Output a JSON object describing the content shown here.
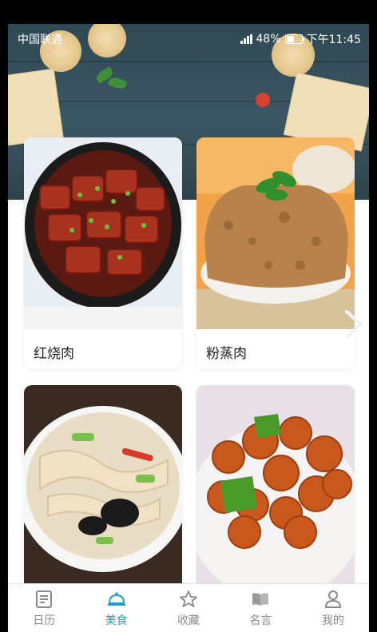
{
  "status_bar": {
    "carrier": "中国联通",
    "battery": "48%",
    "time": "下午11:45"
  },
  "dishes": [
    {
      "name": "红烧肉"
    },
    {
      "name": "粉蒸肉"
    },
    {
      "name": "",
      "photo": "shredded chicken salad with wood ear fungus"
    },
    {
      "name": "",
      "photo": "sweet and sour pork with green peppers"
    }
  ],
  "tabs": [
    {
      "label": "日历",
      "icon": "calendar-note-icon",
      "active": false
    },
    {
      "label": "美食",
      "icon": "food-cloche-icon",
      "active": true
    },
    {
      "label": "收藏",
      "icon": "star-icon",
      "active": false
    },
    {
      "label": "名言",
      "icon": "book-icon",
      "active": false
    },
    {
      "label": "我的",
      "icon": "person-icon",
      "active": false
    }
  ],
  "colors": {
    "accent": "#1e9ec6",
    "inactive": "#8a8a8a",
    "hero": "#34505b"
  }
}
